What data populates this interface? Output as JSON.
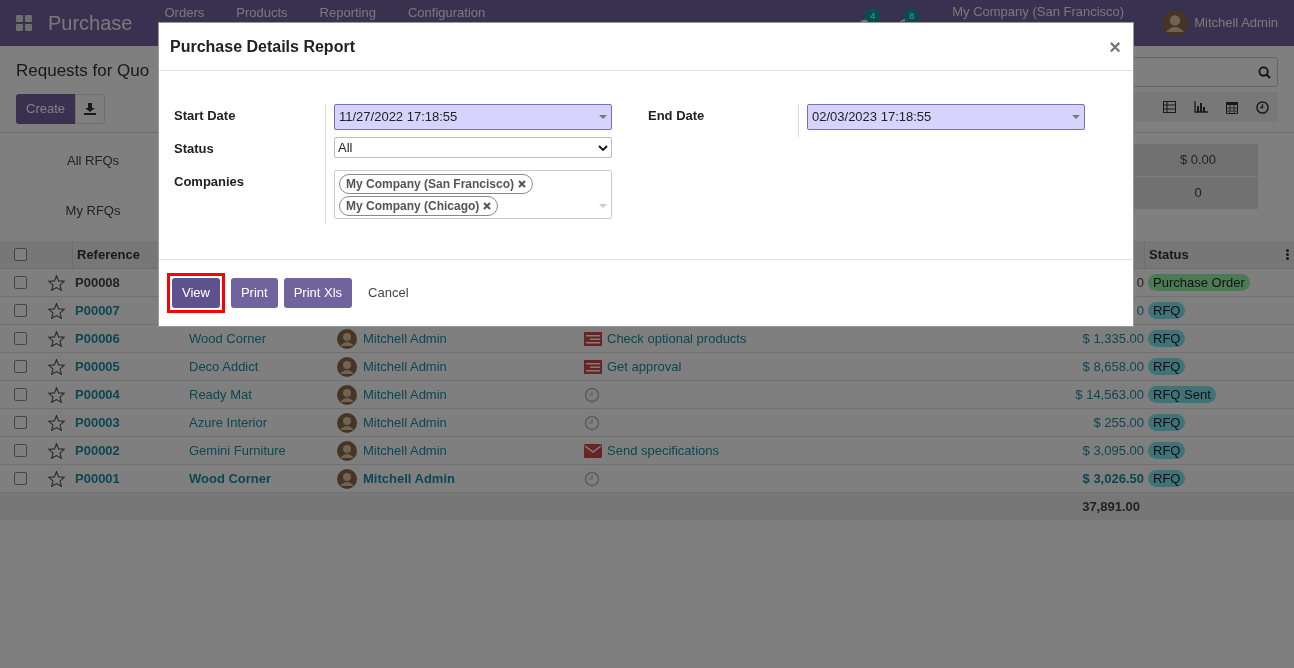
{
  "navbar": {
    "app_name": "Purchase",
    "menu": [
      "Orders",
      "Products",
      "Reporting",
      "Configuration"
    ],
    "messages_badge": "4",
    "activities_badge": "8",
    "company": "My Company (San Francisco)",
    "user": "Mitchell Admin"
  },
  "control_panel": {
    "title": "Requests for Quo",
    "create_button": "Create"
  },
  "dashboard": {
    "labels": [
      "All RFQs",
      "My RFQs"
    ],
    "values": [
      "$ 0.00",
      "0"
    ]
  },
  "table": {
    "columns": {
      "reference": "Reference",
      "status": "Status"
    },
    "select_all_checked": false,
    "rows": [
      {
        "checked": false,
        "reference": "P00008",
        "amount": "0",
        "status": "Purchase Order",
        "color": "#4a7b55",
        "linked": false,
        "emphasized": false
      },
      {
        "checked": false,
        "reference": "P00007",
        "amount": "0",
        "status": "RFQ",
        "color": "#3f7377",
        "linked": true,
        "emphasized": false
      },
      {
        "checked": false,
        "reference": "P00006",
        "vendor": "Wood Corner",
        "buyer": "Mitchell Admin",
        "activity": {
          "kind": "todo",
          "text": "Check optional products"
        },
        "amount": "$ 1,335.00",
        "status": "RFQ",
        "color": "#3f7377",
        "linked": true,
        "emphasized": false
      },
      {
        "checked": false,
        "reference": "P00005",
        "vendor": "Deco Addict",
        "buyer": "Mitchell Admin",
        "activity": {
          "kind": "todo",
          "text": "Get approval"
        },
        "amount": "$ 8,658.00",
        "status": "RFQ",
        "color": "#3f7377",
        "linked": true,
        "emphasized": false
      },
      {
        "checked": false,
        "reference": "P00004",
        "vendor": "Ready Mat",
        "buyer": "Mitchell Admin",
        "activity": {
          "kind": "none"
        },
        "amount": "$ 14,563.00",
        "status": "RFQ Sent",
        "color": "#3f7377",
        "linked": true,
        "emphasized": false
      },
      {
        "checked": false,
        "reference": "P00003",
        "vendor": "Azure Interior",
        "buyer": "Mitchell Admin",
        "activity": {
          "kind": "none"
        },
        "amount": "$ 255.00",
        "status": "RFQ",
        "color": "#3f7377",
        "linked": true,
        "emphasized": false
      },
      {
        "checked": false,
        "reference": "P00002",
        "vendor": "Gemini Furniture",
        "buyer": "Mitchell Admin",
        "activity": {
          "kind": "email",
          "text": "Send specifications"
        },
        "amount": "$ 3,095.00",
        "status": "RFQ",
        "color": "#3f7377",
        "linked": true,
        "emphasized": false
      },
      {
        "checked": false,
        "reference": "P00001",
        "vendor": "Wood Corner",
        "buyer": "Mitchell Admin",
        "activity": {
          "kind": "none"
        },
        "amount": "$ 3,026.50",
        "status": "RFQ",
        "color": "#3f7377",
        "linked": true,
        "emphasized": true
      }
    ],
    "total": "37,891.00"
  },
  "dialog": {
    "title": "Purchase Details Report",
    "close": "×",
    "start_date": {
      "label": "Start Date",
      "value": "11/27/2022 17:18:55"
    },
    "end_date": {
      "label": "End Date",
      "value": "02/03/2023 17:18:55"
    },
    "status": {
      "label": "Status",
      "value": "All"
    },
    "companies": {
      "label": "Companies",
      "tags": [
        "My Company (San Francisco)",
        "My Company (Chicago)"
      ]
    },
    "buttons": [
      {
        "label": "View",
        "kind": "primary",
        "highlighted": true
      },
      {
        "label": "Print",
        "kind": "primary",
        "highlighted": false
      },
      {
        "label": "Print Xls",
        "kind": "primary",
        "highlighted": false
      },
      {
        "label": "Cancel",
        "kind": "link",
        "highlighted": false
      }
    ]
  }
}
